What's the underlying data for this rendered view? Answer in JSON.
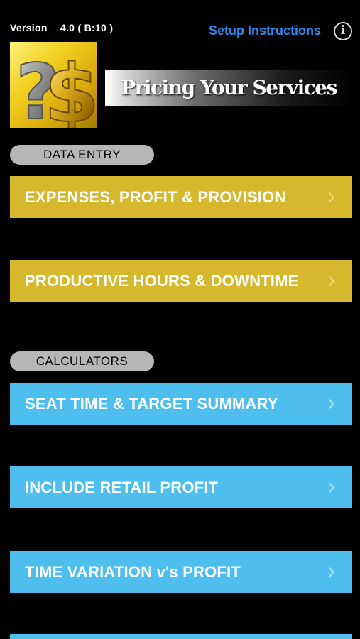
{
  "header": {
    "version_label": "Version",
    "version_number": "4.0 ( B:10 )",
    "setup_link": "Setup Instructions",
    "info_icon": "info-circle-icon"
  },
  "logo": {
    "icon": "question-dollar-logo",
    "glyphs": "?$"
  },
  "title": "Pricing Your Services",
  "sections": {
    "data_entry": "DATA ENTRY",
    "calculators": "CALCULATORS"
  },
  "buttons": [
    {
      "label": "EXPENSES, PROFIT & PROVISION",
      "color": "#d5b82b"
    },
    {
      "label": "PRODUCTIVE HOURS & DOWNTIME",
      "color": "#d5b82b"
    },
    {
      "label": "SEAT TIME & TARGET SUMMARY",
      "color": "#4ebeef"
    },
    {
      "label": "INCLUDE RETAIL PROFIT",
      "color": "#4ebeef"
    },
    {
      "label": "TIME VARIATION v's PROFIT",
      "color": "#4ebeef"
    }
  ],
  "colors": {
    "background": "#000000",
    "link": "#2b8bf0",
    "data_entry_button": "#d5b82b",
    "calculator_button": "#4ebeef",
    "section_pill": "#b6b6b6"
  }
}
